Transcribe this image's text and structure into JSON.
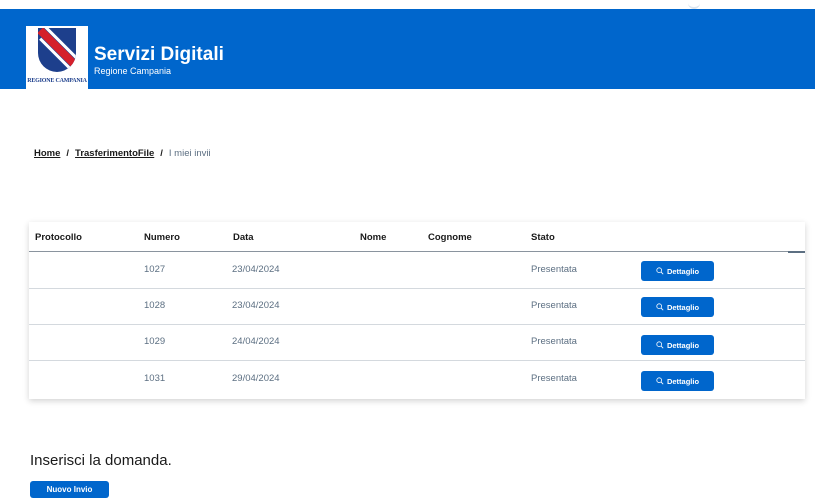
{
  "header": {
    "logo_text": "REGIONE CAMPANIA",
    "title": "Servizi Digitali",
    "subtitle": "Regione Campania",
    "bg_color": "#0066cc"
  },
  "breadcrumb": {
    "items": [
      {
        "label": "Home"
      },
      {
        "label": "TrasferimentoFile"
      }
    ],
    "separator": "/",
    "current": "I miei invii"
  },
  "table": {
    "columns": [
      "Protocollo",
      "Numero",
      "Data",
      "Nome",
      "Cognome",
      "Stato"
    ],
    "rows": [
      {
        "protocollo": "",
        "numero": "1027",
        "data": "23/04/2024",
        "nome": "",
        "cognome": "",
        "stato": "Presentata",
        "action": "Dettaglio"
      },
      {
        "protocollo": "",
        "numero": "1028",
        "data": "23/04/2024",
        "nome": "",
        "cognome": "",
        "stato": "Presentata",
        "action": "Dettaglio"
      },
      {
        "protocollo": "",
        "numero": "1029",
        "data": "24/04/2024",
        "nome": "",
        "cognome": "",
        "stato": "Presentata",
        "action": "Dettaglio"
      },
      {
        "protocollo": "",
        "numero": "1031",
        "data": "29/04/2024",
        "nome": "",
        "cognome": "",
        "stato": "Presentata",
        "action": "Dettaglio"
      }
    ],
    "action_icon": "search-icon"
  },
  "section": {
    "title": "Inserisci la domanda.",
    "new_button": "Nuovo Invio"
  }
}
